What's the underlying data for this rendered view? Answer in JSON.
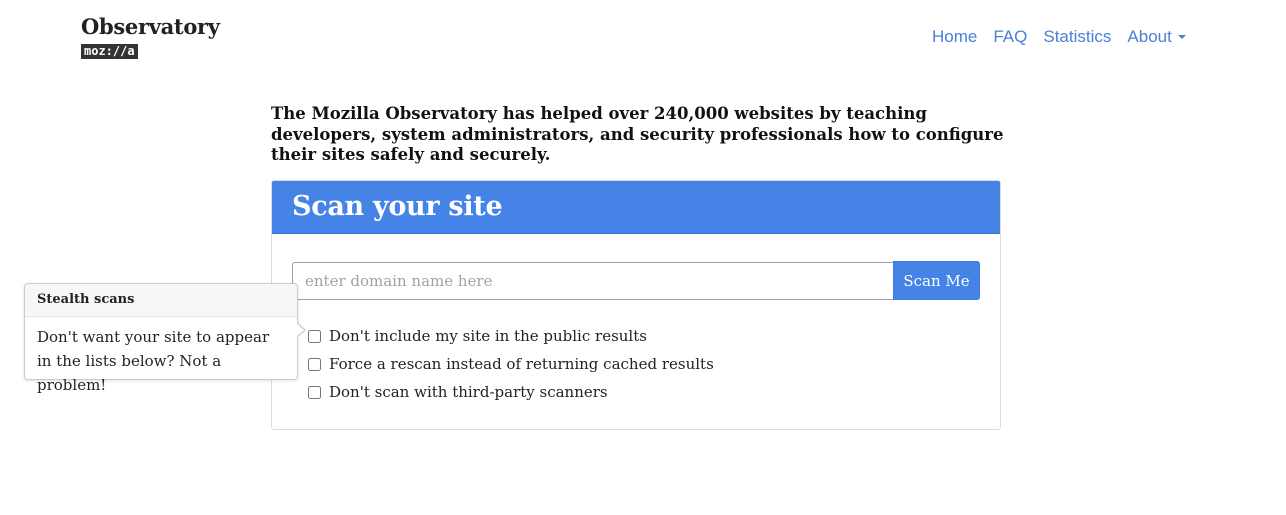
{
  "header": {
    "brand_title": "Observatory",
    "brand_logo": "moz://a",
    "nav": [
      {
        "label": "Home"
      },
      {
        "label": "FAQ"
      },
      {
        "label": "Statistics"
      },
      {
        "label": "About"
      }
    ]
  },
  "intro": {
    "text": "The Mozilla Observatory has helped over 240,000 websites by teaching developers, system administrators, and security professionals how to configure their sites safely and securely."
  },
  "scan_card": {
    "title": "Scan your site",
    "input_placeholder": "enter domain name here",
    "input_value": "",
    "button_label": "Scan Me",
    "options": [
      {
        "label": "Don't include my site in the public results",
        "checked": false
      },
      {
        "label": "Force a rescan instead of returning cached results",
        "checked": false
      },
      {
        "label": "Don't scan with third-party scanners",
        "checked": false
      }
    ]
  },
  "popover": {
    "title": "Stealth scans",
    "body": "Don't want your site to appear in the lists below? Not a problem!"
  },
  "colors": {
    "accent": "#4583e6",
    "link": "#4a7fd6"
  }
}
